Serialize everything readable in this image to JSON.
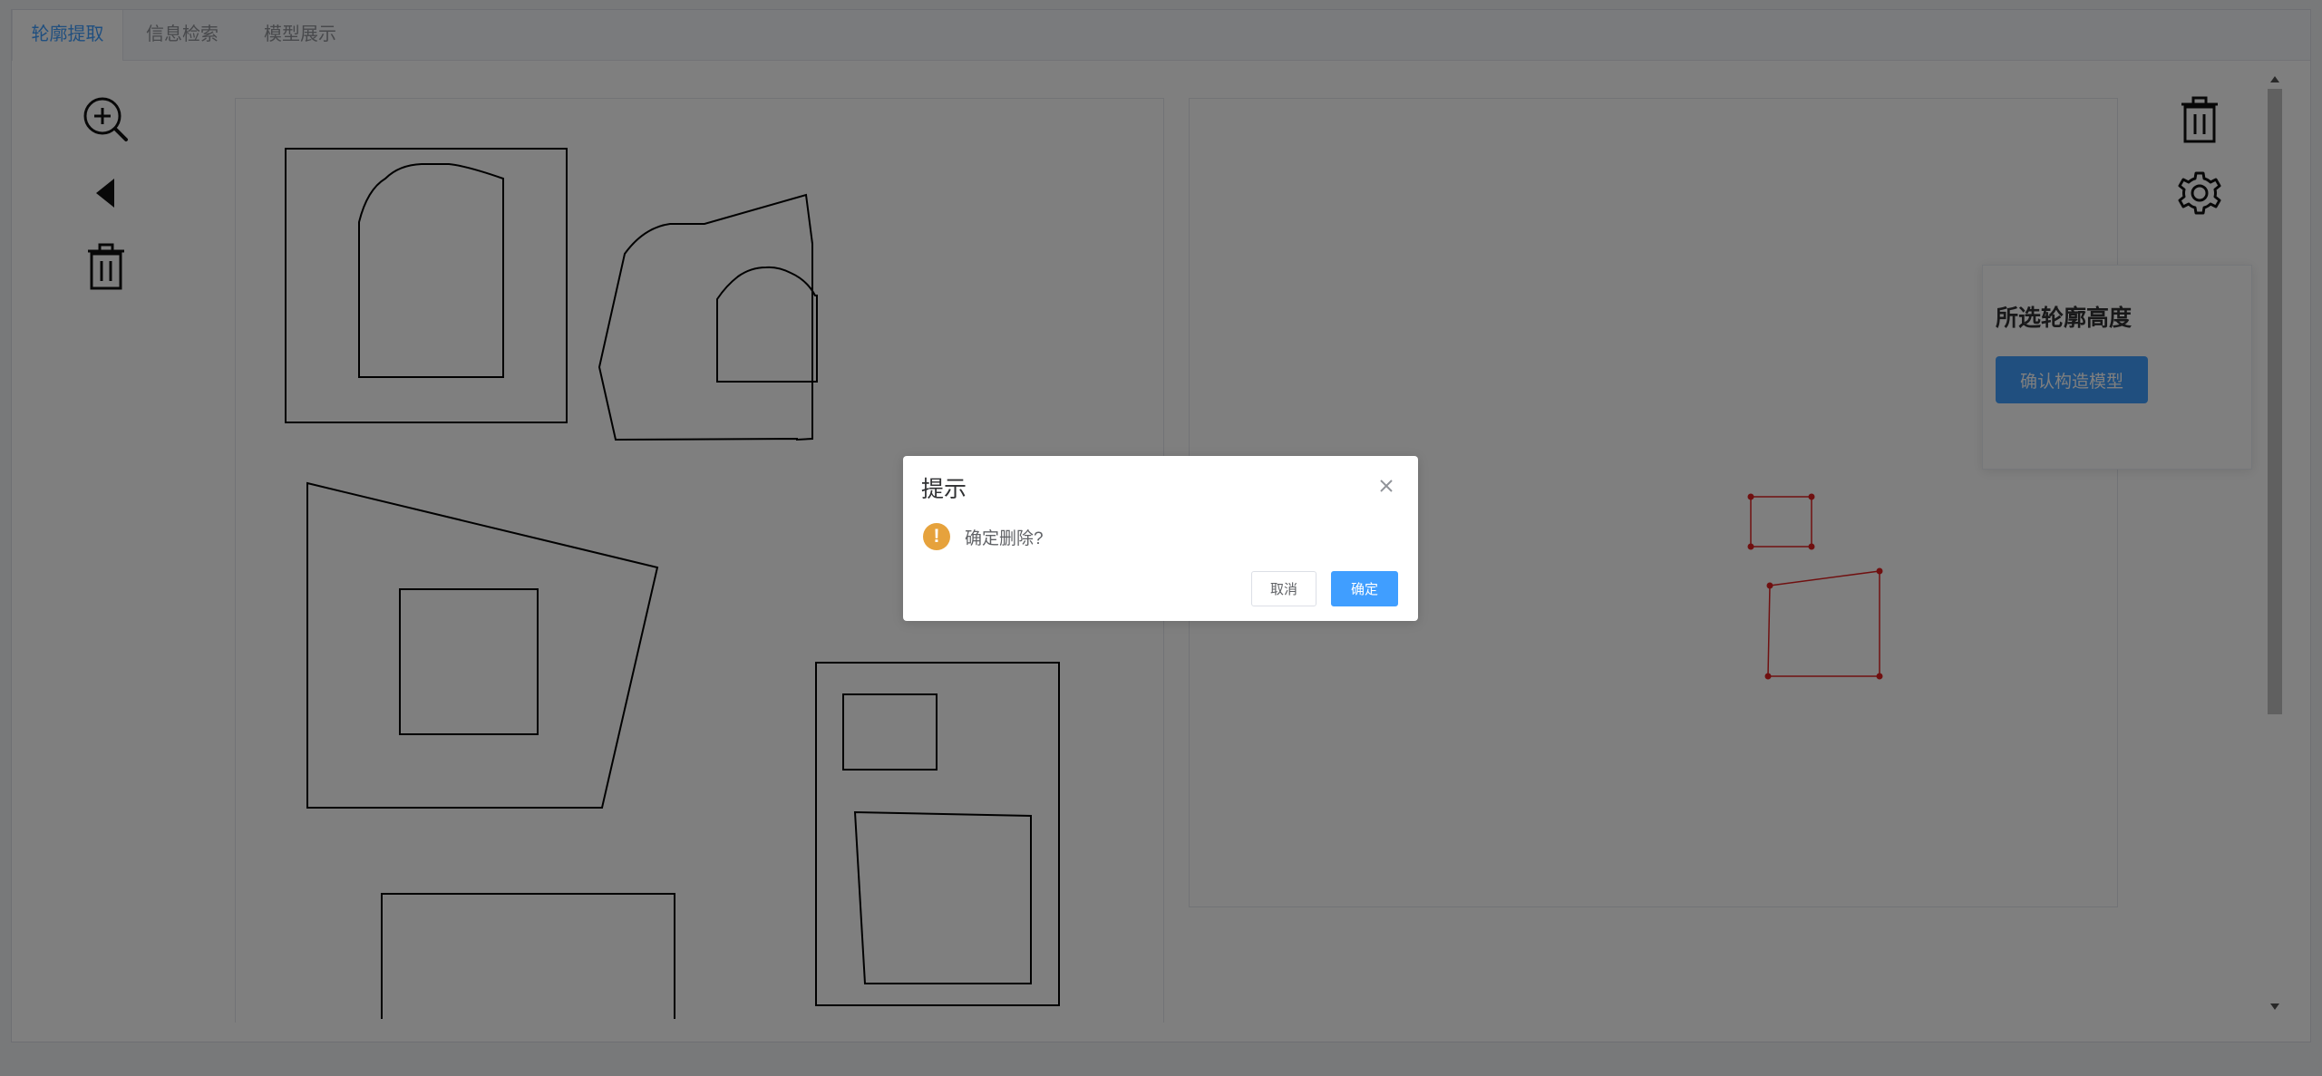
{
  "tabs": [
    {
      "label": "轮廓提取",
      "active": true
    },
    {
      "label": "信息检索",
      "active": false
    },
    {
      "label": "模型展示",
      "active": false
    }
  ],
  "left_toolbar": {
    "icons": [
      "zoom-in-icon",
      "back-triangle-icon",
      "trash-icon"
    ]
  },
  "right_toolbar": {
    "icons": [
      "trash-icon",
      "settings-gear-icon"
    ]
  },
  "panel": {
    "title": "所选轮廓高度",
    "button_label": "确认构造模型"
  },
  "dialog": {
    "title": "提示",
    "message": "确定删除?",
    "cancel_label": "取消",
    "confirm_label": "确定",
    "icon": "warning-icon"
  },
  "colors": {
    "accent": "#409eff",
    "warning": "#e6a23c",
    "contour_selected": "#e02020",
    "contour": "#000000"
  }
}
